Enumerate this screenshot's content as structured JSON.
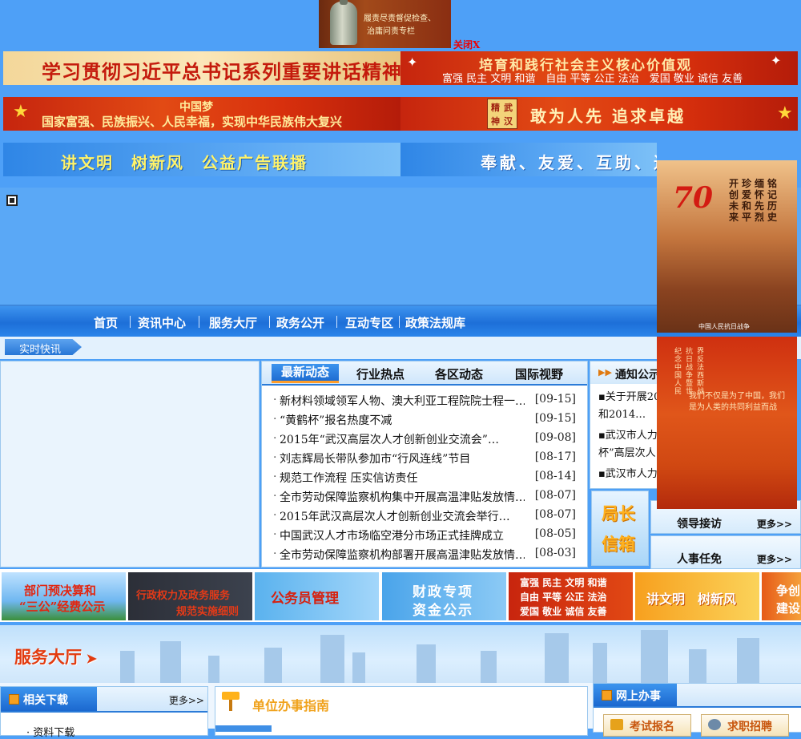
{
  "top_ad": {
    "line1": "履责尽责督促检查、",
    "line2": "治庸问责专栏",
    "close_label": "关闭X"
  },
  "banners": {
    "row1_left": "学习贯彻习近平总书记系列重要讲话精神",
    "row1_right_main": "培育和践行社会主义核心价值观",
    "row1_right_sub": "富强 民主 文明 和谐　自由 平等 公正 法治　爱国 敬业 诚信 友善",
    "row2_left_a": "中国梦",
    "row2_left_b": "国家富强、民族振兴、人民幸福，实现中华民族伟大复兴",
    "row2_right_box": [
      "精",
      "武",
      "神",
      "汉"
    ],
    "row2_right_main": "敢为人先  追求卓越",
    "row3_left": "讲文明　树新风　公益广告联播",
    "row3_right": "奉献、友爱、互助、进步"
  },
  "nav": {
    "items": [
      "首页",
      "资讯中心",
      "服务大厅",
      "政务公开",
      "互动专区",
      "政策法规库"
    ]
  },
  "live_news_label": "实时快讯",
  "news": {
    "tabs": [
      "最新动态",
      "行业热点",
      "各区动态",
      "国际视野"
    ],
    "rows": [
      {
        "title": "新材料领域领军人物、澳大利亚工程院院士程一…",
        "date": "[09-15]"
      },
      {
        "title": "“黄鹤杯”报名热度不减",
        "date": "[09-15]"
      },
      {
        "title": "2015年“武汉高层次人才创新创业交流会”…",
        "date": "[09-08]"
      },
      {
        "title": "刘志辉局长带队参加市“行风连线”节目",
        "date": "[08-17]"
      },
      {
        "title": "规范工作流程 压实信访责任",
        "date": "[08-14]"
      },
      {
        "title": "全市劳动保障监察机构集中开展高温津贴发放情…",
        "date": "[08-07]"
      },
      {
        "title": "2015年武汉高层次人才创新创业交流会举行…",
        "date": "[08-07]"
      },
      {
        "title": "中国武汉人才市场临空港分市场正式挂牌成立",
        "date": "[08-05]"
      },
      {
        "title": "全市劳动保障监察机构部署开展高温津贴发放情…",
        "date": "[08-03]"
      }
    ]
  },
  "notice": {
    "title": "通知公示",
    "items": [
      "▪关于开展20",
      "和2014…",
      "▪武汉市人力",
      "杯”高层次人",
      "▪武汉市人力"
    ]
  },
  "chief_mailbox": {
    "line1": "局长",
    "line2": "信箱"
  },
  "side_boxes": [
    {
      "label": "领导接访",
      "more": "更多>>"
    },
    {
      "label": "人事任免",
      "more": "更多>>"
    }
  ],
  "posters": {
    "poster1_badge": "70",
    "poster1_cols": [
      "铭记历史",
      "缅怀先烈",
      "珍爱和平",
      "开创未来"
    ],
    "poster1_foot": "中国人民抗日战争",
    "poster2_cols": [
      "纪念中国人民",
      "抗日战争暨世",
      "界反法西斯战"
    ],
    "poster2_caption": "我们不仅是为了中国，我们是为人类的共同利益而战"
  },
  "promos": [
    {
      "l1": "部门预决算和",
      "l2": "“三公”经费公示"
    },
    {
      "l1": "行政权力及政务服务",
      "l2": "规范实施细则"
    },
    {
      "l1": "公务员管理",
      "l2": ""
    },
    {
      "l1": "财政专项",
      "l2": "资金公示"
    },
    {
      "l1": "富强 民主 文明 和谐",
      "l2": "自由 平等 公正 法治",
      "l3": "爱国 敬业 诚信 友善"
    },
    {
      "l1": "讲文明　树新风",
      "l2": ""
    },
    {
      "l1": "争创",
      "l2": "建设"
    }
  ],
  "service_hall": {
    "title": "服务大厅"
  },
  "downloads": {
    "title": "相关下载",
    "more": "更多>>",
    "first_row": "· 资料下载"
  },
  "guide": {
    "title": "单位办事指南"
  },
  "online": {
    "title": "网上办事",
    "buttons": [
      "考试报名",
      "求职招聘"
    ]
  },
  "colors": {
    "nav_blue": "#1d6fd8",
    "banner_red": "#d8300d",
    "accent_orange": "#ff9d2a"
  }
}
